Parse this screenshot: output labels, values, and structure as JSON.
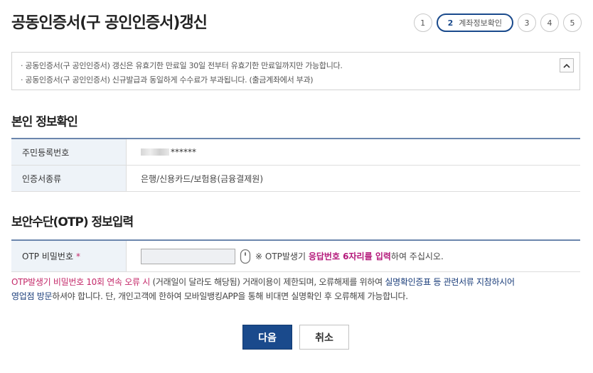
{
  "page": {
    "title": "공동인증서(구 공인인증서)갱신"
  },
  "steps": {
    "s1": "1",
    "s2_num": "2",
    "s2_label": "계좌정보확인",
    "s3": "3",
    "s4": "4",
    "s5": "5"
  },
  "notice": {
    "line1": "· 공동인증서(구 공인인증서) 갱신은 유효기한 만료일 30일 전부터 유효기한 만료일까지만 가능합니다.",
    "line2": "· 공동인증서(구 공인인증서) 신규발급과 동일하게 수수료가 부과됩니다. (출금계좌에서 부과)",
    "toggle_icon": "chevron-up-icon"
  },
  "identity": {
    "title": "본인 정보확인",
    "rows": [
      {
        "label": "주민등록번호",
        "value": "******"
      },
      {
        "label": "인증서종류",
        "value": "은행/신용카드/보험용(금융결제원)"
      }
    ]
  },
  "otp": {
    "title": "보안수단(OTP) 정보입력",
    "label": "OTP 비밀번호",
    "required": "*",
    "input_value": "",
    "help_prefix": "※ OTP발생기 ",
    "help_highlight": "응답번호 6자리를 입력",
    "help_suffix": "하여 주십시오.",
    "mouse_icon": "mouse-icon"
  },
  "warning": {
    "p1": "OTP발생기 비밀번호 10회 연속 오류 시",
    "p2": " (거래일이 달라도 해당됨) 거래이용이 제한되며, 오류해제를 위하여 ",
    "p3": "실명확인증표 등 관련서류 지참하시어",
    "p4": "영업점 방문",
    "p5": "하셔야 합니다. 단, 개인고객에 한하여 모바일뱅킹APP을 통해 비대면 실명확인 후 오류해제 가능합니다."
  },
  "buttons": {
    "next": "다음",
    "cancel": "취소"
  },
  "colors": {
    "primary": "#1a4a8c",
    "highlight": "#b4187a",
    "table_border": "#6b86ad",
    "header_bg": "#eef3f8"
  }
}
